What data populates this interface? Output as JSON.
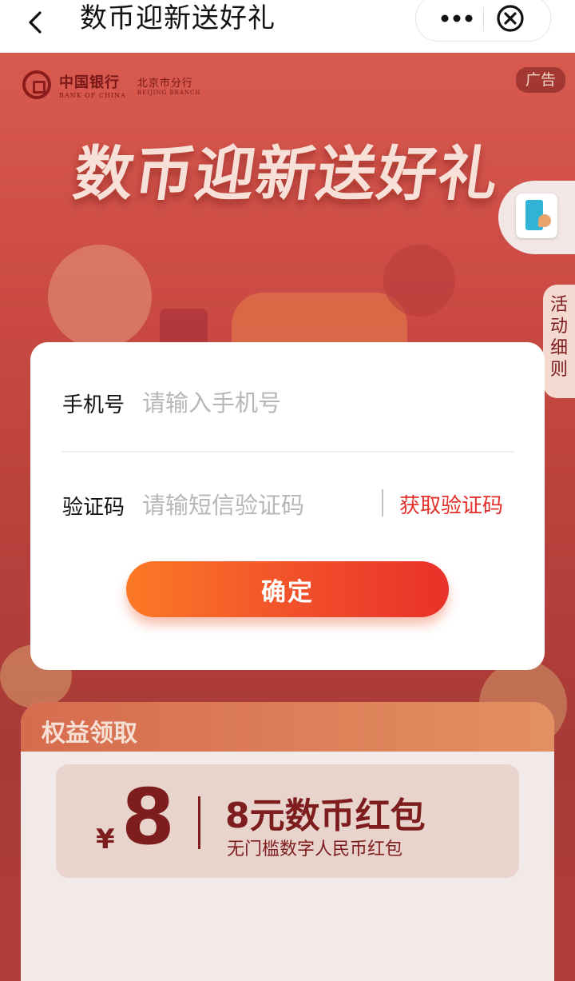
{
  "nav": {
    "title": "数币迎新送好礼",
    "back_icon": "chevron-left-icon",
    "more_icon": "more-dots-icon",
    "close_icon": "close-circle-icon"
  },
  "bank": {
    "name_cn": "中国银行",
    "name_en": "BANK OF CHINA",
    "branch_cn": "北京市分行",
    "branch_en": "BEIJING BRANCH"
  },
  "ad_badge": "广告",
  "hero_title": "数币迎新送好礼",
  "side": {
    "float_icon": "phone-tap-icon",
    "rules_chars": [
      "活",
      "动",
      "细",
      "则"
    ]
  },
  "form": {
    "phone_label": "手机号",
    "phone_placeholder": "请输入手机号",
    "phone_value": "",
    "code_label": "验证码",
    "code_placeholder": "请输短信验证码",
    "code_value": "",
    "get_code": "获取验证码",
    "confirm": "确定"
  },
  "rights": {
    "title": "权益领取",
    "currency": "¥",
    "amount": "8",
    "coupon_title": "8元数币红包",
    "coupon_sub": "无门槛数字人民币红包"
  },
  "colors": {
    "accent": "#e3302a",
    "button_start": "#fb7926",
    "button_end": "#e8312a",
    "overlay_bg": "#c94843"
  }
}
